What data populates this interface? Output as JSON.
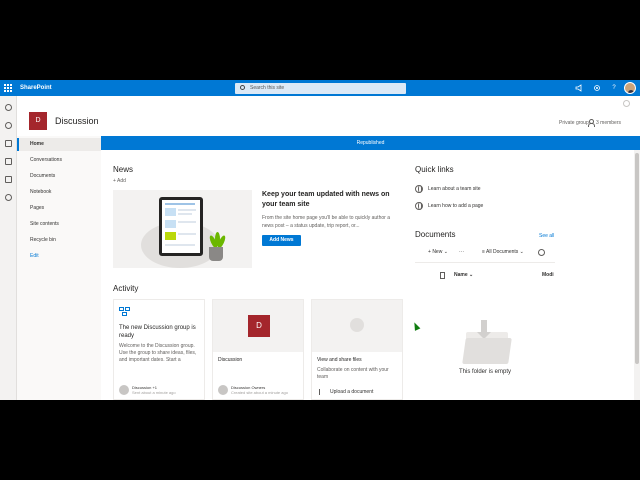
{
  "suite_bar": {
    "app_name": "SharePoint",
    "search_placeholder": "Search this site",
    "icons": [
      "waffle-icon",
      "megaphone-icon",
      "settings-icon",
      "help-icon",
      "profile-avatar"
    ]
  },
  "site": {
    "logo_letter": "D",
    "title": "Discussion",
    "privacy": "Private group",
    "members": "3 members"
  },
  "nav": {
    "items": [
      {
        "label": "Home",
        "selected": true
      },
      {
        "label": "Conversations"
      },
      {
        "label": "Documents"
      },
      {
        "label": "Notebook"
      },
      {
        "label": "Pages"
      },
      {
        "label": "Site contents"
      },
      {
        "label": "Recycle bin"
      },
      {
        "label": "Edit"
      }
    ]
  },
  "banner": {
    "text": "Republished"
  },
  "news": {
    "title": "News",
    "add_label": "+ Add",
    "headline": "Keep your team updated with news on your team site",
    "body": "From the site home page you'll be able to quickly author a news post – a status update, trip report, or...",
    "button": "Add News"
  },
  "activity": {
    "title": "Activity",
    "cards": [
      {
        "title": "The new Discussion group is ready",
        "desc": "Welcome to the Discussion group. Use the group to share ideas, files, and important dates. Start a",
        "user": "Discussion +1",
        "time": "Sent about a minute ago"
      },
      {
        "logo_letter": "D",
        "title": "Discussion",
        "user": "Discussion Owners",
        "time": "Created site about a minute ago"
      },
      {
        "title": "View and share files",
        "desc": "Collaborate on content with your team",
        "action": "Upload a document"
      }
    ]
  },
  "quick_links": {
    "title": "Quick links",
    "items": [
      "Learn about a team site",
      "Learn how to add a page"
    ]
  },
  "documents": {
    "title": "Documents",
    "see_all": "See all",
    "new_label": "New",
    "more_label": "···",
    "view_label": "All Documents",
    "col_name": "Name",
    "col_modified": "Modi",
    "empty_text": "This folder is empty"
  }
}
